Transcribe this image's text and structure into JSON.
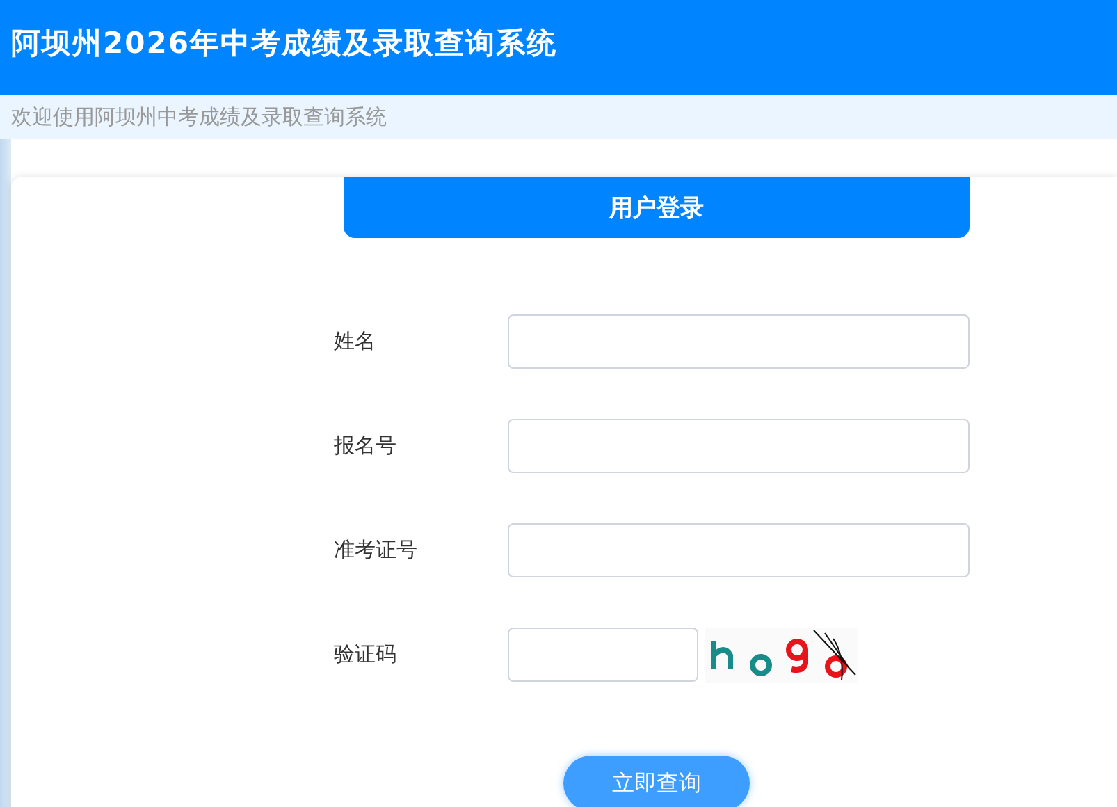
{
  "header": {
    "title": "阿坝州2026年中考成绩及录取查询系统"
  },
  "welcome": "欢迎使用阿坝州中考成绩及录取查询系统",
  "login": {
    "title": "用户登录",
    "fields": [
      {
        "kind": "text",
        "label": "姓名"
      },
      {
        "kind": "text",
        "label": "报名号"
      },
      {
        "kind": "text",
        "label": "准考证号"
      },
      {
        "kind": "captcha",
        "label": "验证码"
      }
    ],
    "submit": "立即查询"
  }
}
